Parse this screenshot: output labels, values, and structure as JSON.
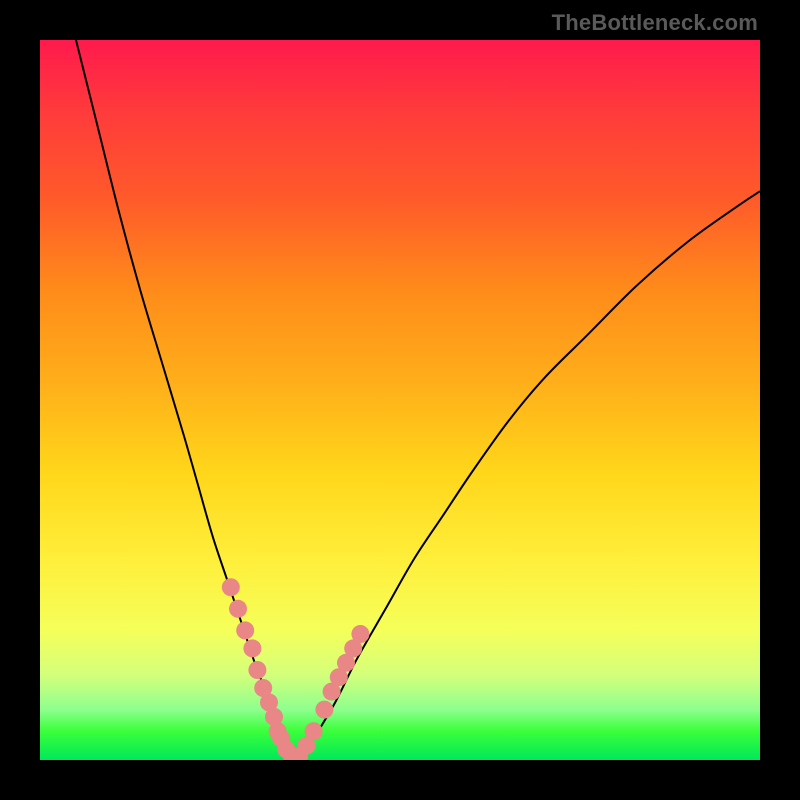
{
  "attribution": "TheBottleneck.com",
  "chart_data": {
    "type": "line",
    "title": "",
    "xlabel": "",
    "ylabel": "",
    "xlim": [
      0,
      100
    ],
    "ylim": [
      0,
      100
    ],
    "grid": false,
    "legend": false,
    "series": [
      {
        "name": "bottleneck-curve",
        "x": [
          5,
          8,
          11,
          14,
          17,
          20,
          22,
          24,
          26,
          28,
          30,
          32,
          33,
          34,
          35,
          36,
          38,
          41,
          44,
          48,
          52,
          56,
          60,
          65,
          70,
          76,
          83,
          90,
          97,
          100
        ],
        "y": [
          100,
          88,
          76,
          65,
          55,
          45,
          38,
          31,
          25,
          19,
          13,
          8,
          5,
          3,
          1,
          0,
          3,
          8,
          14,
          21,
          28,
          34,
          40,
          47,
          53,
          59,
          66,
          72,
          77,
          79
        ]
      }
    ],
    "points": {
      "name": "highlight-dots",
      "x": [
        26.5,
        27.5,
        28.5,
        29.5,
        30.2,
        31,
        31.8,
        32.5,
        33,
        33.5,
        34.2,
        35,
        36,
        37,
        38,
        39.5,
        40.5,
        41.5,
        42.5,
        43.5,
        44.5
      ],
      "y": [
        24,
        21,
        18,
        15.5,
        12.5,
        10,
        8,
        6,
        4,
        3,
        1.5,
        0.5,
        0.5,
        2,
        4,
        7,
        9.5,
        11.5,
        13.5,
        15.5,
        17.5
      ]
    },
    "gradient_stops": [
      {
        "pos": 0,
        "color": "#ff1a4d"
      },
      {
        "pos": 10,
        "color": "#ff3b3b"
      },
      {
        "pos": 22,
        "color": "#ff5a2a"
      },
      {
        "pos": 35,
        "color": "#ff8c1a"
      },
      {
        "pos": 48,
        "color": "#ffb01a"
      },
      {
        "pos": 60,
        "color": "#ffd61a"
      },
      {
        "pos": 72,
        "color": "#ffee3a"
      },
      {
        "pos": 82,
        "color": "#f5ff5a"
      },
      {
        "pos": 88,
        "color": "#d5ff7a"
      },
      {
        "pos": 93,
        "color": "#8eff8e"
      },
      {
        "pos": 96,
        "color": "#3aff3a"
      },
      {
        "pos": 100,
        "color": "#00e85a"
      }
    ]
  }
}
